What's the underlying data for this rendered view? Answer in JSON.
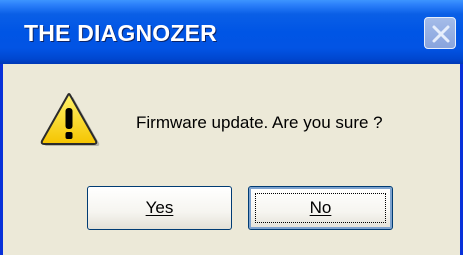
{
  "window": {
    "title": "THE DIAGNOZER",
    "close_icon": "close-icon"
  },
  "dialog": {
    "icon": "warning-icon",
    "message": "Firmware update. Are you sure ?",
    "buttons": {
      "yes_label": "Yes",
      "no_label": "No",
      "default": "No"
    }
  },
  "colors": {
    "titlebar": "#0055e5",
    "dialog_background": "#ece9d8",
    "title_text": "#ffffff",
    "warning_yellow": "#ffd800"
  }
}
